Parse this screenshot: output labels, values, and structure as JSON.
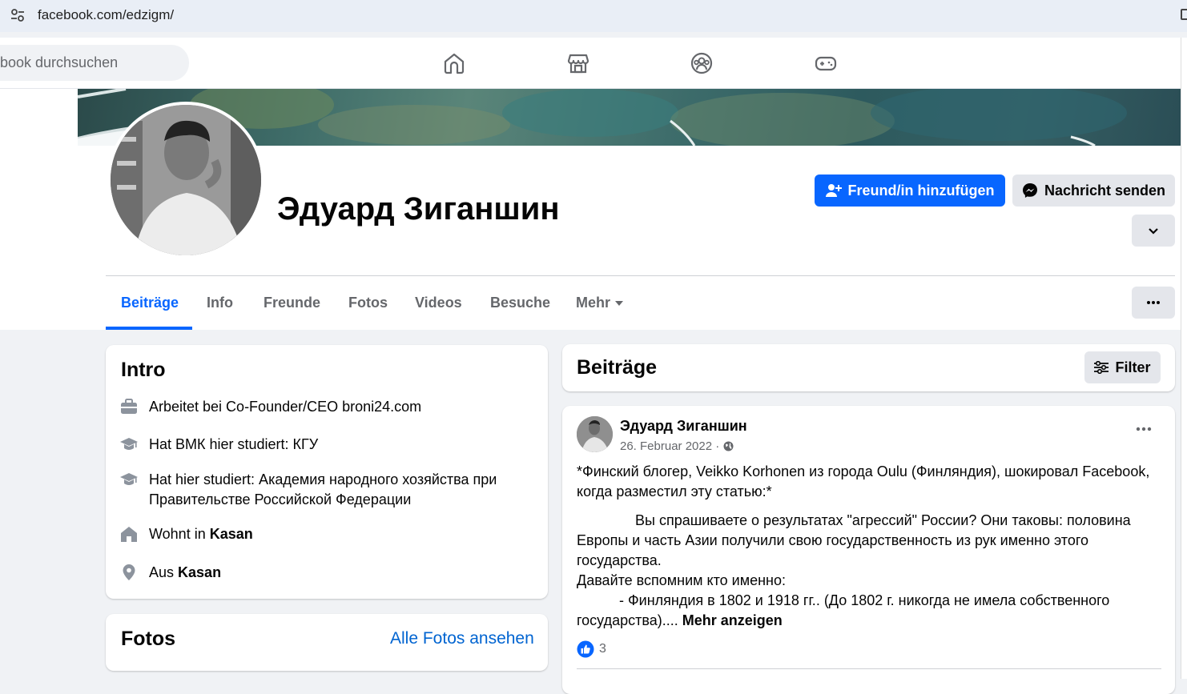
{
  "browser": {
    "url": "facebook.com/edzigm/"
  },
  "topnav": {
    "search_placeholder": "book durchsuchen",
    "icons": [
      "home-icon",
      "marketplace-icon",
      "groups-icon",
      "gaming-icon"
    ]
  },
  "profile": {
    "name": "Эдуард Зиганшин",
    "add_friend_label": "Freund/in hinzufügen",
    "message_label": "Nachricht senden"
  },
  "tabs": [
    {
      "label": "Beiträge",
      "active": true
    },
    {
      "label": "Info"
    },
    {
      "label": "Freunde"
    },
    {
      "label": "Fotos"
    },
    {
      "label": "Videos"
    },
    {
      "label": "Besuche"
    },
    {
      "label": "Mehr"
    }
  ],
  "intro": {
    "title": "Intro",
    "items": [
      {
        "icon": "briefcase-icon",
        "prefix": "Arbeitet bei Co-Founder/CEO broni24.com",
        "bold": ""
      },
      {
        "icon": "graduation-cap-icon",
        "prefix": "Hat ВМК hier studiert: КГУ",
        "bold": ""
      },
      {
        "icon": "graduation-cap-icon",
        "prefix": "Hat hier studiert: Академия народного хозяйства при Правительстве Российской Федерации",
        "bold": ""
      },
      {
        "icon": "house-icon",
        "prefix": "Wohnt in ",
        "bold": "Kasan"
      },
      {
        "icon": "location-pin-icon",
        "prefix": "Aus ",
        "bold": "Kasan"
      }
    ]
  },
  "fotos": {
    "title": "Fotos",
    "see_all": "Alle Fotos ansehen"
  },
  "posts": {
    "title": "Beiträge",
    "filter_label": "Filter",
    "post": {
      "author": "Эдуард Зиганшин",
      "date": "26. Februar 2022 ·",
      "para1": "*Финский блогер, Veikko Korhonen из города Oulu (Финляндия),  шокировал Facebook, когда разместил эту статью:*",
      "para2": "Вы спрашиваете о результатах \"агрессий\" России? Они таковы: половина Европы и часть Азии получили свою государственность из рук именно этого государства.",
      "para3": "Давайте вспомним кто именно:",
      "para4": "- Финляндия в 1802 и 1918 гг.. (До 1802 г. никогда не имела собственного государства)....",
      "more": "Mehr anzeigen",
      "like_count": "3"
    }
  },
  "colors": {
    "primary": "#0866ff",
    "link": "#0064d1",
    "secondary_text": "#65676b",
    "button_gray": "#e4e6eb"
  }
}
